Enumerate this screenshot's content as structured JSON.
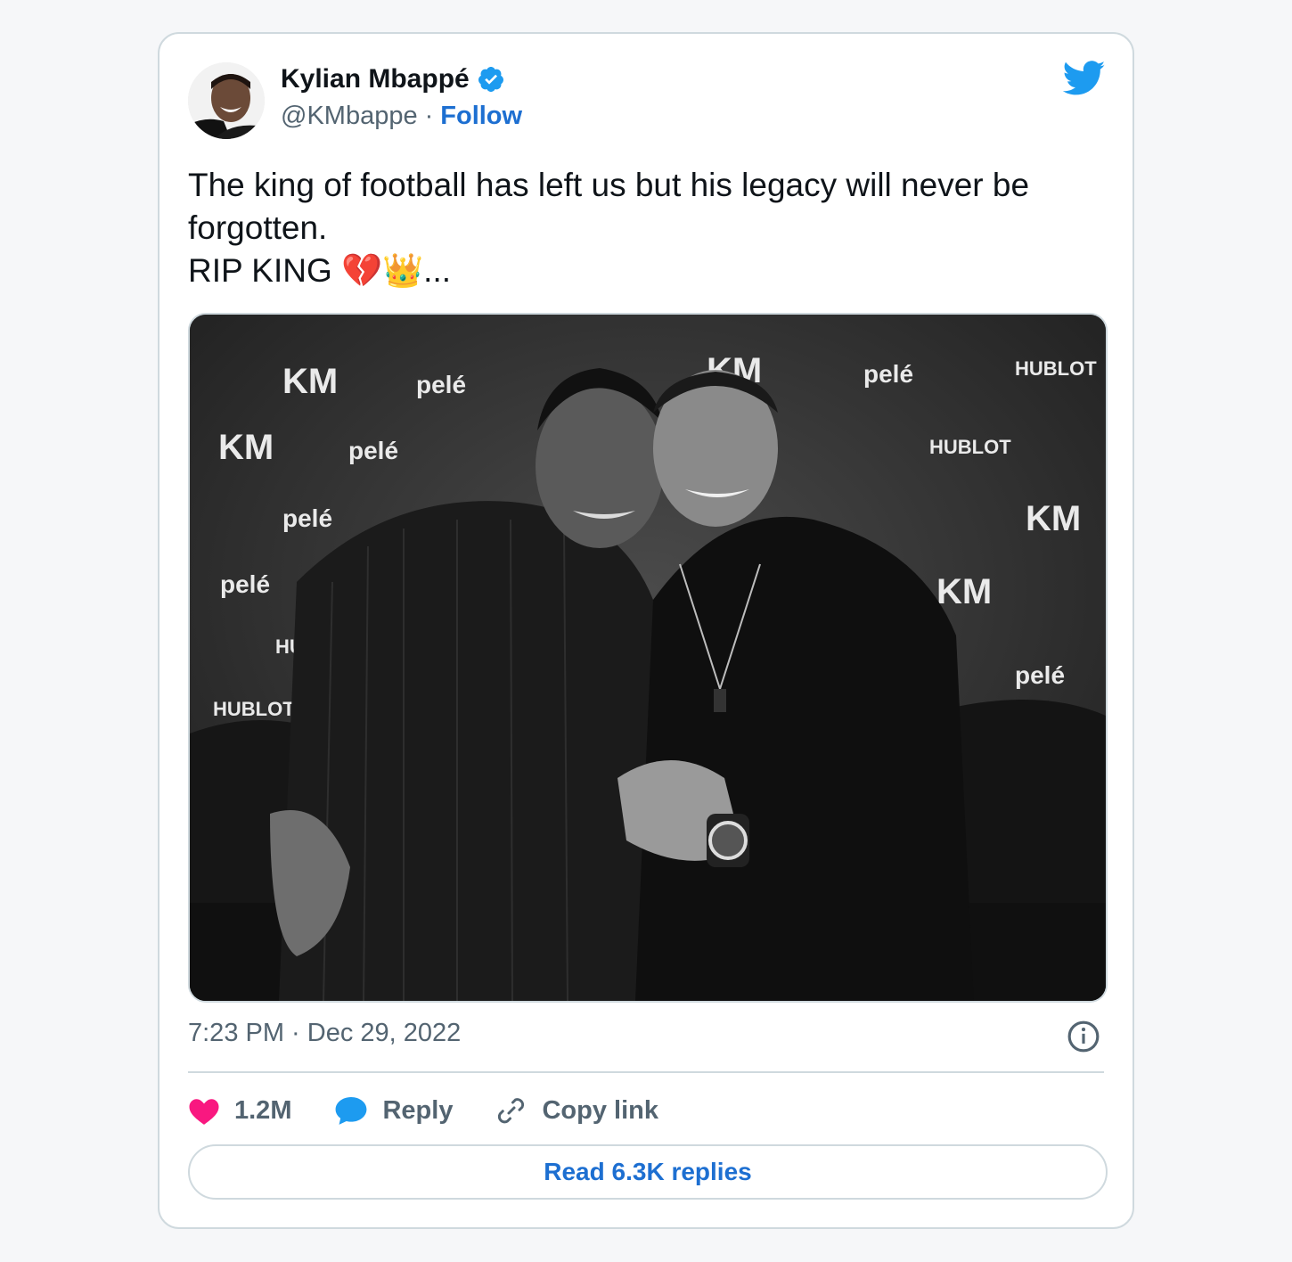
{
  "author": {
    "name": "Kylian Mbappé",
    "handle": "@KMbappe",
    "separator": "·",
    "follow_label": "Follow",
    "verified": true
  },
  "tweet": {
    "lines": [
      "The king of football has left us but his legacy will never be",
      "forgotten.",
      "RIP KING 💔👑..."
    ],
    "timestamp": "7:23 PM · Dec 29, 2022"
  },
  "media": {
    "backdrop_logos": [
      "KM",
      "pelé",
      "HUBLOT"
    ]
  },
  "actions": {
    "likes": "1.2M",
    "reply_label": "Reply",
    "copy_link_label": "Copy link"
  },
  "read_replies_label": "Read 6.3K replies",
  "icons": {
    "brand": "twitter-bird-icon",
    "verified": "verified-badge-icon",
    "like": "heart-icon",
    "reply": "speech-bubble-icon",
    "copy": "link-icon",
    "info": "info-icon"
  },
  "colors": {
    "link_blue": "#1d6fd1",
    "twitter_blue": "#1d9bf0",
    "heart_pink": "#f91880",
    "muted_text": "#536471",
    "border": "#cfd9de"
  }
}
